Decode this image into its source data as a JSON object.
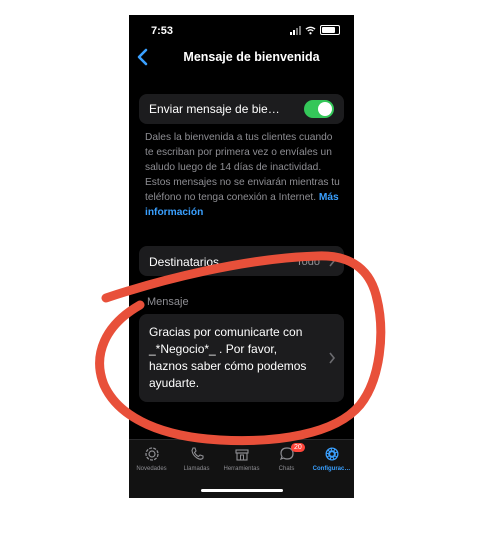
{
  "status": {
    "time": "7:53"
  },
  "nav": {
    "title": "Mensaje de bienvenida"
  },
  "toggle": {
    "label": "Enviar mensaje de bie…",
    "on": true
  },
  "description": {
    "text": "Dales la bienvenida a tus clientes cuando te escriban por primera vez o envíales un saludo luego de 14 días de inactividad. Estos mensajes no se enviarán mientras tu teléfono no tenga conexión a Internet.",
    "link": "Más información"
  },
  "recipients": {
    "label": "Destinatarios",
    "value": "Todo"
  },
  "section": {
    "title": "Mensaje"
  },
  "message": {
    "text": "Gracias por comunicarte con _*Negocio*_ . Por favor, haznos saber cómo podemos ayudarte."
  },
  "tabs": [
    {
      "label": "Novedades",
      "icon": "novedades-icon"
    },
    {
      "label": "Llamadas",
      "icon": "phone-icon"
    },
    {
      "label": "Herramientas",
      "icon": "tools-icon"
    },
    {
      "label": "Chats",
      "icon": "chats-icon",
      "badge": "20"
    },
    {
      "label": "Configurac…",
      "icon": "settings-icon",
      "active": true
    }
  ],
  "colors": {
    "accent": "#3aa0ff",
    "switch_on": "#34c759",
    "annotation": "#e8503a",
    "badge": "#ff453a"
  }
}
